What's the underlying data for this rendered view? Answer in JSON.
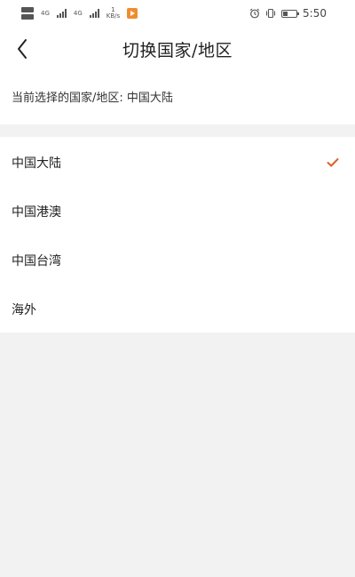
{
  "status_bar": {
    "network_left": "4G",
    "network_right": "4G",
    "speed_value": "1",
    "speed_unit": "KB/s",
    "time": "5:50",
    "battery_level": 0.35
  },
  "header": {
    "title": "切换国家/地区"
  },
  "current_selection": {
    "text": "当前选择的国家/地区: 中国大陆"
  },
  "regions": [
    {
      "label": "中国大陆",
      "selected": true
    },
    {
      "label": "中国港澳",
      "selected": false
    },
    {
      "label": "中国台湾",
      "selected": false
    },
    {
      "label": "海外",
      "selected": false
    }
  ],
  "colors": {
    "accent": "#d9622b",
    "background_gray": "#f2f2f2"
  }
}
